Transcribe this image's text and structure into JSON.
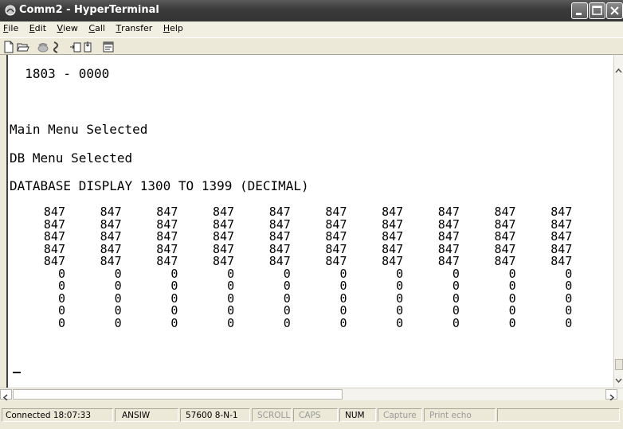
{
  "window": {
    "title": "Comm2 - HyperTerminal"
  },
  "menu": [
    {
      "pre": "",
      "key": "F",
      "post": "ile"
    },
    {
      "pre": "",
      "key": "E",
      "post": "dit"
    },
    {
      "pre": "",
      "key": "V",
      "post": "iew"
    },
    {
      "pre": "",
      "key": "C",
      "post": "all"
    },
    {
      "pre": "",
      "key": "T",
      "post": "ransfer"
    },
    {
      "pre": "",
      "key": "H",
      "post": "elp"
    }
  ],
  "toolbar": [
    "new-document-icon",
    "open-folder-icon",
    "dial-phone-icon",
    "disconnect-icon",
    "send-icon",
    "receive-icon",
    "properties-icon"
  ],
  "terminal": {
    "line1": "  1803 - 0000",
    "line2": "Main Menu Selected",
    "line3": "DB Menu Selected",
    "line4": "DATABASE DISPLAY 1300 TO 1399 (DECIMAL)",
    "columns": [
      [
        "847",
        "847",
        "847",
        "847",
        "847",
        "0",
        "0",
        "0",
        "0",
        "0"
      ],
      [
        "847",
        "847",
        "847",
        "847",
        "847",
        "0",
        "0",
        "0",
        "0",
        "0"
      ],
      [
        "847",
        "847",
        "847",
        "847",
        "847",
        "0",
        "0",
        "0",
        "0",
        "0"
      ],
      [
        "847",
        "847",
        "847",
        "847",
        "847",
        "0",
        "0",
        "0",
        "0",
        "0"
      ],
      [
        "847",
        "847",
        "847",
        "847",
        "847",
        "0",
        "0",
        "0",
        "0",
        "0"
      ],
      [
        "847",
        "847",
        "847",
        "847",
        "847",
        "0",
        "0",
        "0",
        "0",
        "0"
      ],
      [
        "847",
        "847",
        "847",
        "847",
        "847",
        "0",
        "0",
        "0",
        "0",
        "0"
      ],
      [
        "847",
        "847",
        "847",
        "847",
        "847",
        "0",
        "0",
        "0",
        "0",
        "0"
      ],
      [
        "847",
        "847",
        "847",
        "847",
        "847",
        "0",
        "0",
        "0",
        "0",
        "0"
      ],
      [
        "847",
        "847",
        "847",
        "847",
        "847",
        "0",
        "0",
        "0",
        "0",
        "0"
      ]
    ]
  },
  "status": {
    "connected": "Connected 18:07:33",
    "emulation": "ANSIW",
    "settings": "57600 8-N-1",
    "scroll": "SCROLL",
    "caps": "CAPS",
    "num": "NUM",
    "capture": "Capture",
    "print_echo": "Print echo"
  }
}
